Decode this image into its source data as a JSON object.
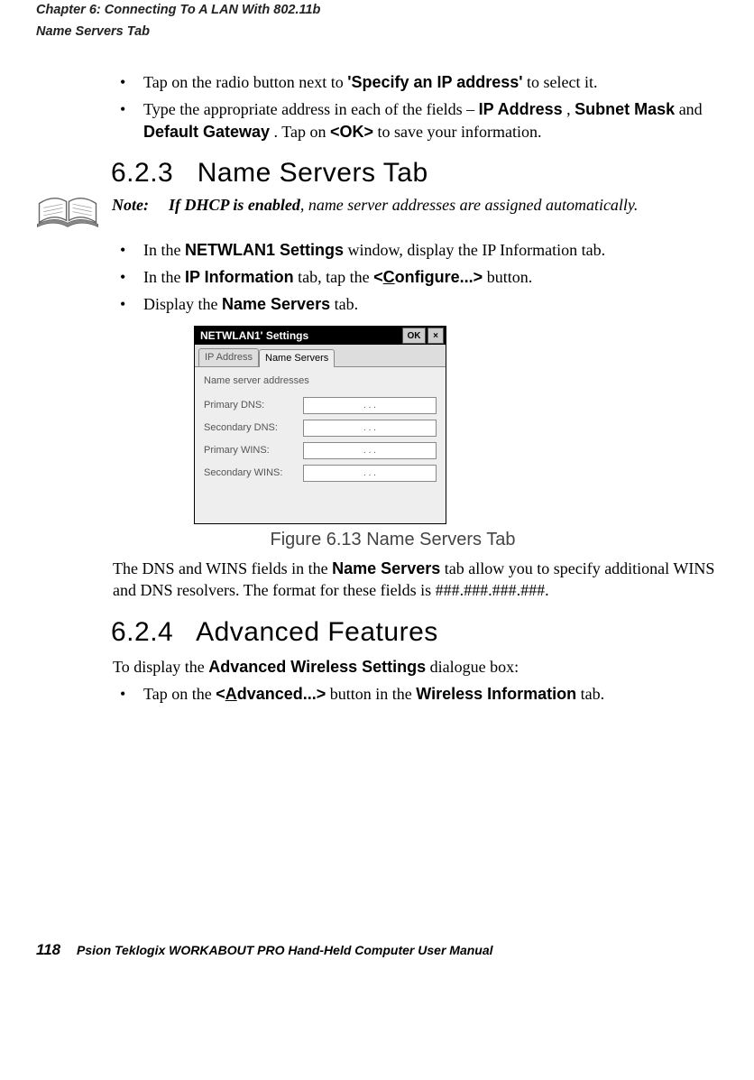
{
  "header": {
    "chapter": "Chapter 6: Connecting To A LAN With 802.11b",
    "section": "Name Servers Tab"
  },
  "bullets_top": [
    {
      "prefix": "Tap on the radio button next to ",
      "q1": "'Specify an IP address'",
      "suffix": " to select it."
    },
    {
      "prefix": "Type the appropriate address in each of the fields – ",
      "f1": "IP Address",
      "c1": ", ",
      "f2": "Subnet Mask",
      "c2": " and ",
      "f3": "Default Gateway",
      "mid": ". Tap on ",
      "ok": "<OK>",
      "suffix": " to save your information."
    }
  ],
  "sec623": {
    "num": "6.2.3",
    "title": "Name Servers Tab"
  },
  "note": {
    "label": "Note:",
    "bold": "If DHCP is enabled",
    "rest": ", name server addresses are assigned automatically."
  },
  "bullets_mid": [
    {
      "pre": "In the ",
      "b": "NETWLAN1 Settings",
      "post": " window, display the IP Information tab."
    },
    {
      "pre": "In the ",
      "b": "IP Information",
      "mid": " tab, tap the ",
      "btn_pre": "<",
      "btn_u": "C",
      "btn_post": "onfigure...>",
      "post": " button."
    },
    {
      "pre": "Display the ",
      "b": "Name Servers",
      "post": " tab."
    }
  ],
  "dialog": {
    "title": "NETWLAN1' Settings",
    "ok": "OK",
    "close": "×",
    "tab1": "IP Address",
    "tab2": "Name Servers",
    "heading": "Name server addresses",
    "fields": [
      "Primary DNS:",
      "Secondary DNS:",
      "Primary WINS:",
      "Secondary WINS:"
    ],
    "ipdots": ".     .     ."
  },
  "caption": "Figure 6.13 Name Servers Tab",
  "para1": {
    "pre": "The DNS and WINS fields in the ",
    "b": "Name Servers",
    "post": " tab allow you to specify additional WINS and DNS resolvers. The format for these fields is ###.###.###.###."
  },
  "sec624": {
    "num": "6.2.4",
    "title": "Advanced Features"
  },
  "para2": {
    "pre": "To display the ",
    "b": "Advanced Wireless Settings",
    "post": " dialogue box:"
  },
  "bullets_bot": [
    {
      "pre": "Tap on the ",
      "btn_pre": "<",
      "btn_u": "A",
      "btn_mid": "d",
      "btn_post": "vanced...>",
      "mid": " button in the ",
      "b": "Wireless Information",
      "post": " tab."
    }
  ],
  "footer": {
    "page": "118",
    "text": "Psion Teklogix WORKABOUT PRO Hand-Held Computer User Manual"
  }
}
